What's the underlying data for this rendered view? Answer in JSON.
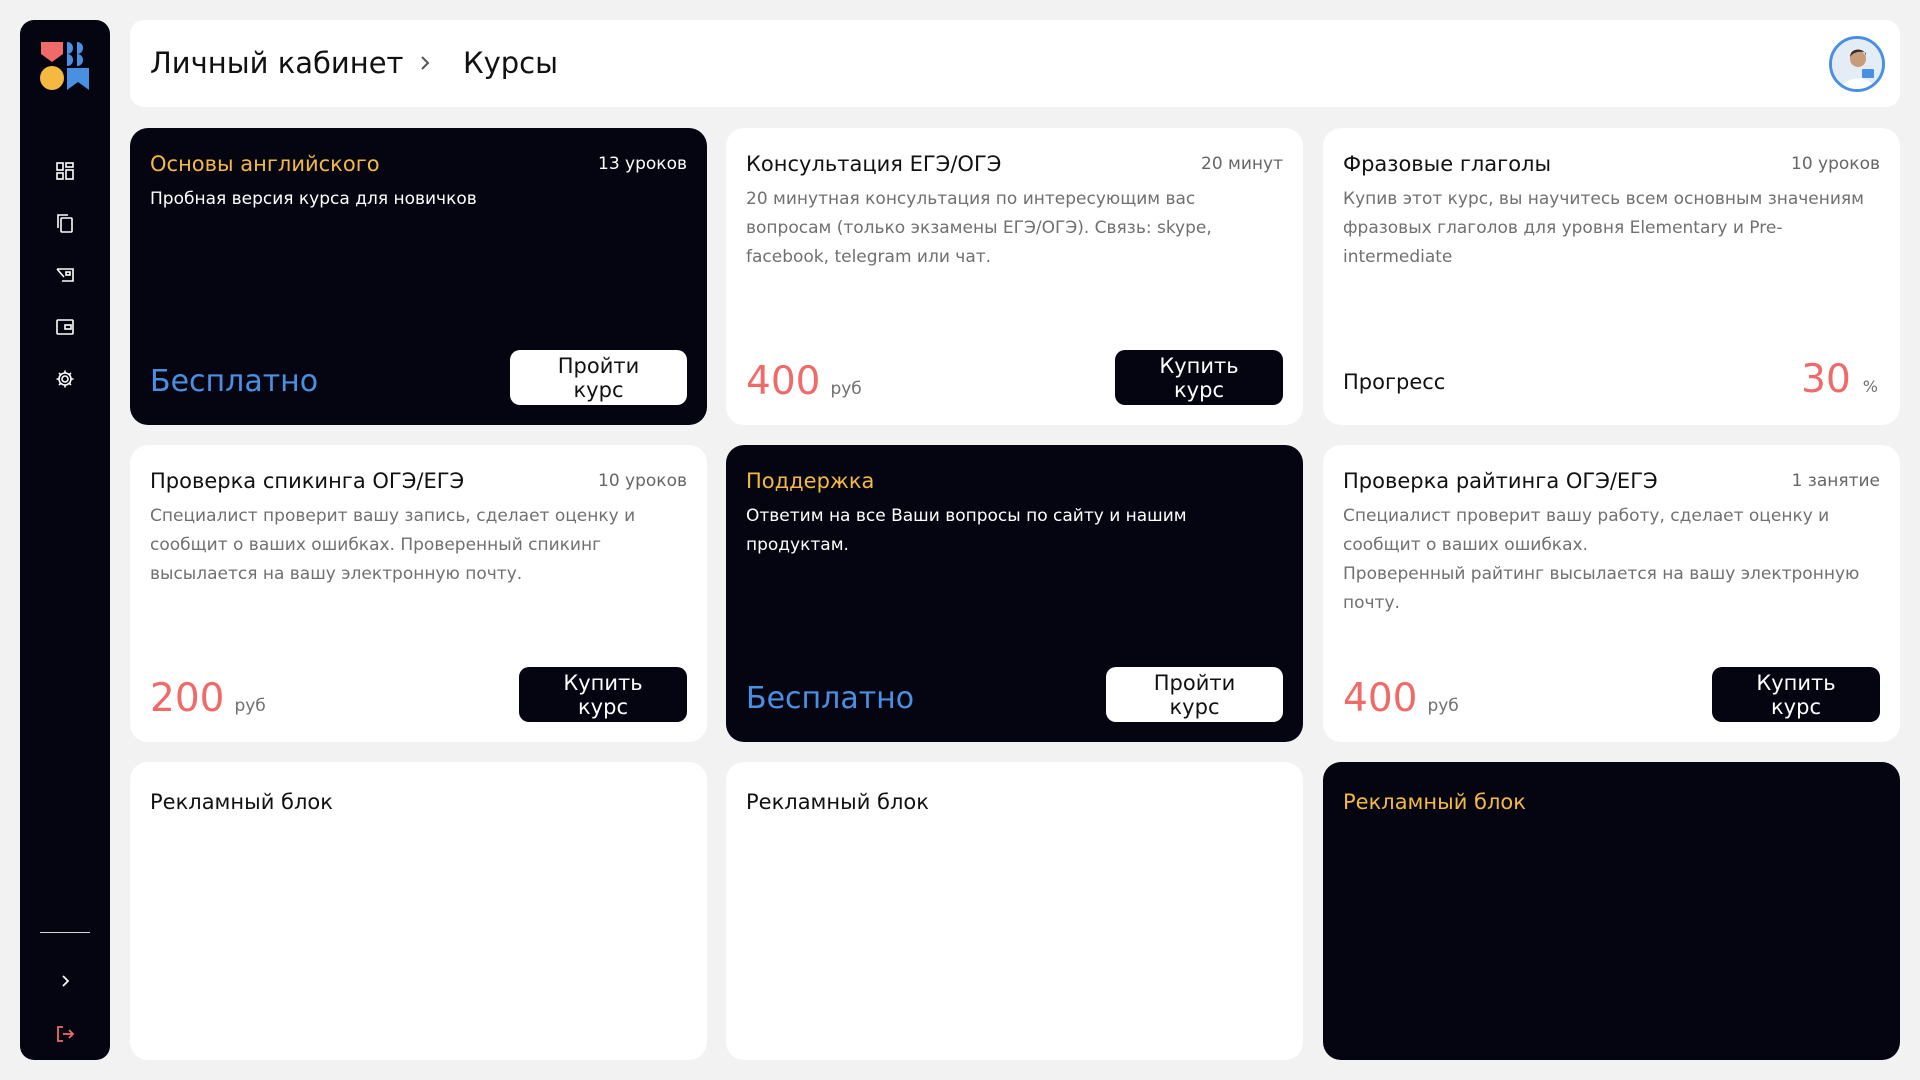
{
  "sidebar": {
    "logo_icon": "brand-logo-icon",
    "items": [
      {
        "icon": "dashboard-icon"
      },
      {
        "icon": "copy-icon"
      },
      {
        "icon": "lessons-icon"
      },
      {
        "icon": "wallet-icon"
      },
      {
        "icon": "gear-icon"
      }
    ],
    "expand_icon": "chevron-right-icon",
    "logout_icon": "logout-icon"
  },
  "header": {
    "breadcrumb_root": "Личный кабинет",
    "breadcrumb_current": "Курсы",
    "separator_icon": "chevron-right-icon"
  },
  "colors": {
    "accent_yellow": "#f5b942",
    "accent_blue": "#4a90e2",
    "accent_red": "#f06a6a",
    "dark": "#050512"
  },
  "cards": [
    {
      "title": "Основы английского",
      "meta": "13 уроков",
      "description": "Пробная версия курса для новичков",
      "free_label": "Бесплатно",
      "button": "Пройти курс"
    },
    {
      "title": "Консультация ЕГЭ/ОГЭ",
      "meta": "20 минут",
      "description": "20 минутная консультация по интересующим вас вопросам (только экзамены ЕГЭ/ОГЭ). Связь: skype, facebook, telegram или чат.",
      "price": "400",
      "currency": "руб",
      "button": "Купить курс"
    },
    {
      "title": "Фразовые глаголы",
      "meta": "10 уроков",
      "description": "Купив этот курс, вы научитесь всем основным значениям фразовых глаголов для уровня Elementary и Pre-intermediate",
      "progress_label": "Прогресс",
      "progress_value": "30",
      "progress_unit": "%"
    },
    {
      "title": "Проверка спикинга ОГЭ/ЕГЭ",
      "meta": "10 уроков",
      "description": "Специалист проверит вашу запись, сделает оценку и сообщит о ваших ошибках. Проверенный спикинг высылается на вашу электронную почту.",
      "price": "200",
      "currency": "руб",
      "button": "Купить курс"
    },
    {
      "title": "Поддержка",
      "description": "Ответим на все Ваши вопросы по сайту и нашим продуктам.",
      "free_label": "Бесплатно",
      "button": "Пройти курс"
    },
    {
      "title": "Проверка райтинга ОГЭ/ЕГЭ",
      "meta": "1 занятие",
      "description": "Специалист проверит вашу работу, сделает оценку и сообщит о ваших ошибках.\nПроверенный райтинг высылается на вашу электронную почту.",
      "price": "400",
      "currency": "руб",
      "button": "Купить курс"
    },
    {
      "title": "Рекламный блок"
    },
    {
      "title": "Рекламный блок"
    },
    {
      "title": "Рекламный блок"
    }
  ]
}
